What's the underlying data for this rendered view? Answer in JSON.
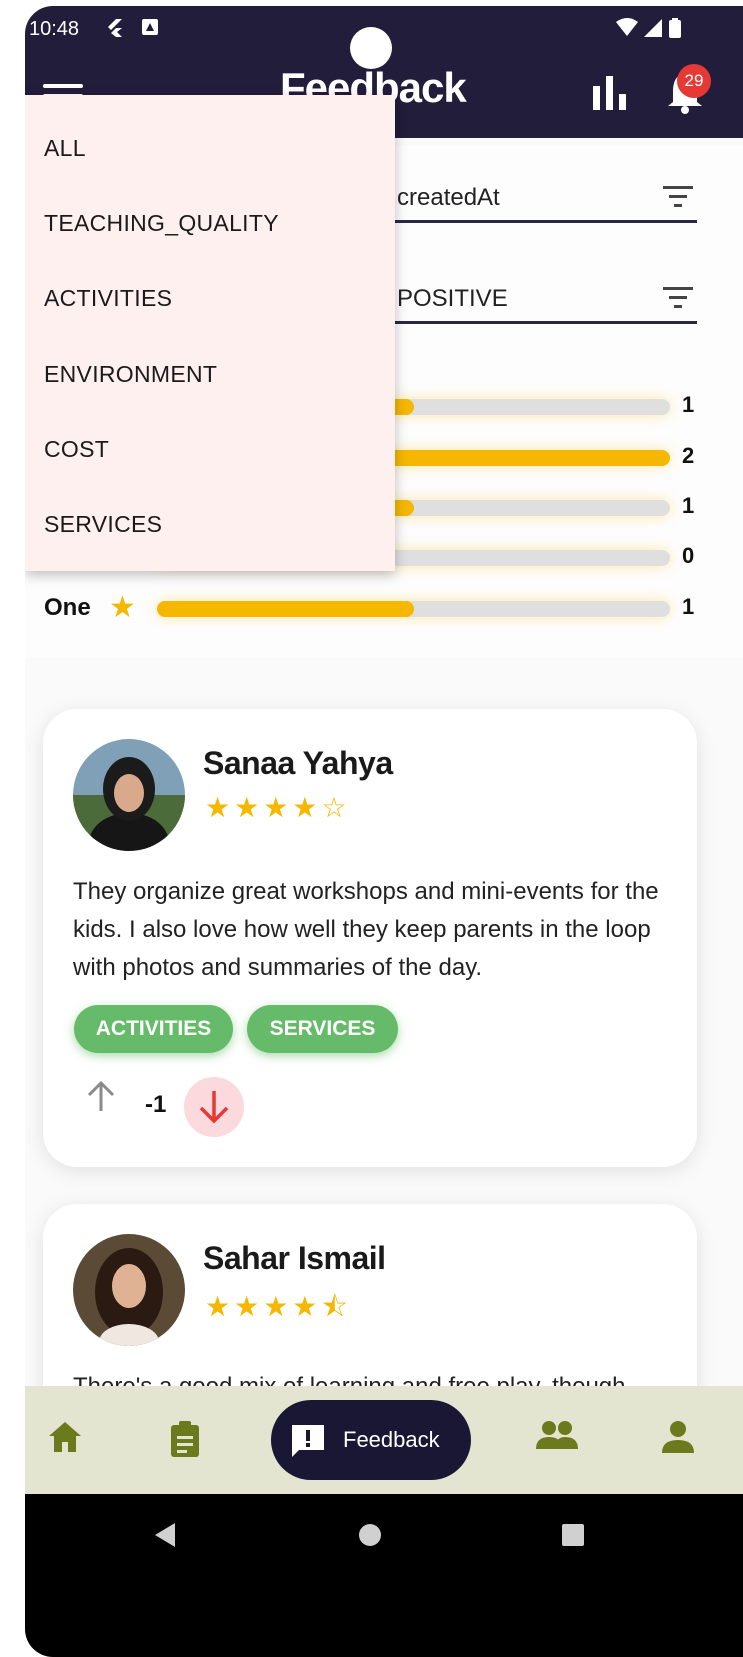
{
  "status_bar": {
    "time": "10:48"
  },
  "header": {
    "title": "Feedback",
    "notification_count": "29"
  },
  "filters": {
    "sort_value": "createdAt",
    "sentiment_value": "POSITIVE"
  },
  "category_menu": {
    "items": [
      "ALL",
      "TEACHING_QUALITY",
      "ACTIVITIES",
      "ENVIRONMENT",
      "COST",
      "SERVICES"
    ]
  },
  "rating_summary": {
    "rows": [
      {
        "label": "",
        "count": "1",
        "fraction": 0.5
      },
      {
        "label": "",
        "count": "2",
        "fraction": 1.0
      },
      {
        "label": "",
        "count": "1",
        "fraction": 0.5
      },
      {
        "label": "",
        "count": "0",
        "fraction": 0.0
      },
      {
        "label": "One",
        "count": "1",
        "fraction": 0.5
      }
    ]
  },
  "reviews": [
    {
      "name": "Sanaa Yahya",
      "rating": 4,
      "stars": "★★★★☆",
      "text": "They organize great workshops and mini-events for the kids. I also love how well they keep parents in the loop with photos and summaries of the day.",
      "tags": [
        "ACTIVITIES",
        "SERVICES"
      ],
      "votes": "-1"
    },
    {
      "name": "Sahar Ismail",
      "rating": 4.5,
      "stars": "★★★★⯪",
      "text": "There's a good mix of learning and free play, though"
    }
  ],
  "bottom_nav": {
    "active_label": "Feedback"
  },
  "colors": {
    "primary_dark": "#211d3b",
    "star": "#f6b700",
    "tag_green": "#66bb6a",
    "nav_bg": "#e3e5d0",
    "nav_icon": "#6b7a1c",
    "badge": "#e53935",
    "downvote": "#e53935"
  }
}
